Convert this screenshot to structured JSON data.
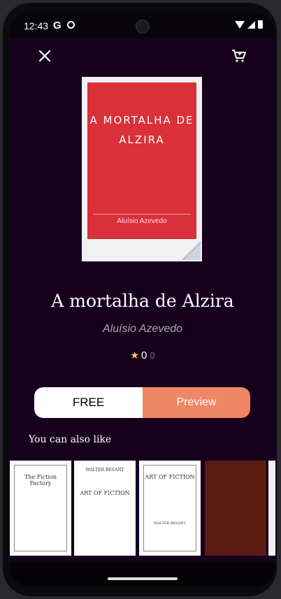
{
  "status_bar": {
    "time": "12:43",
    "google_letter": "G"
  },
  "toolbar": {
    "close_icon": "close-icon",
    "cart_icon": "cart-icon"
  },
  "book": {
    "cover_title": "A MORTALHA DE ALZIRA",
    "cover_author": "Aluísio Azevedo",
    "title": "A mortalha de Alzira",
    "author": "Aluísio Azevedo",
    "rating_value": "0",
    "rating_count": "0"
  },
  "actions": {
    "free_label": "FREE",
    "preview_label": "Preview"
  },
  "recommendations": {
    "heading": "You can also like",
    "items": [
      {
        "cover_title": "The Fiction Factory"
      },
      {
        "cover_author": "WALTER BESANT",
        "cover_title": "ART OF FICTION"
      },
      {
        "cover_title": "ART OF FICTION",
        "cover_author": "WALTER BESANT"
      },
      {
        "cover_title": ""
      },
      {
        "cover_title": ""
      }
    ]
  },
  "colors": {
    "background": "#16001e",
    "accent": "#ef8767",
    "cover_red": "#d9303a"
  }
}
